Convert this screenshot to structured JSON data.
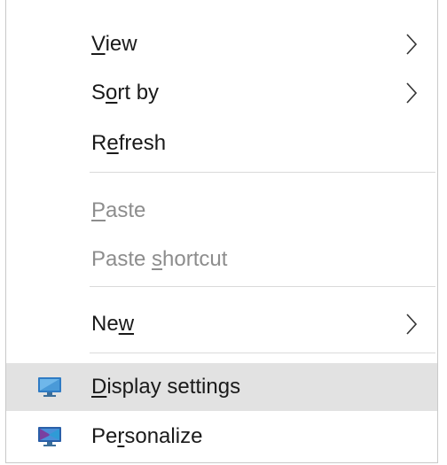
{
  "menu": {
    "items": [
      {
        "pre": "",
        "u": "V",
        "post": "iew"
      },
      {
        "pre": "S",
        "u": "o",
        "post": "rt by"
      },
      {
        "pre": "R",
        "u": "e",
        "post": "fresh"
      },
      {
        "pre": "",
        "u": "P",
        "post": "aste"
      },
      {
        "pre": "Paste ",
        "u": "s",
        "post": "hortcut"
      },
      {
        "pre": "Ne",
        "u": "w",
        "post": ""
      },
      {
        "pre": "",
        "u": "D",
        "post": "isplay settings"
      },
      {
        "pre": "Pe",
        "u": "r",
        "post": "sonalize"
      }
    ]
  },
  "colors": {
    "hover_background": "#e2e2e2",
    "disabled_text": "#8d8d8d",
    "text": "#1a1a1a"
  },
  "icons": {
    "display_settings": "monitor-icon",
    "personalize": "personalize-icon",
    "submenu": "chevron-right-icon"
  }
}
